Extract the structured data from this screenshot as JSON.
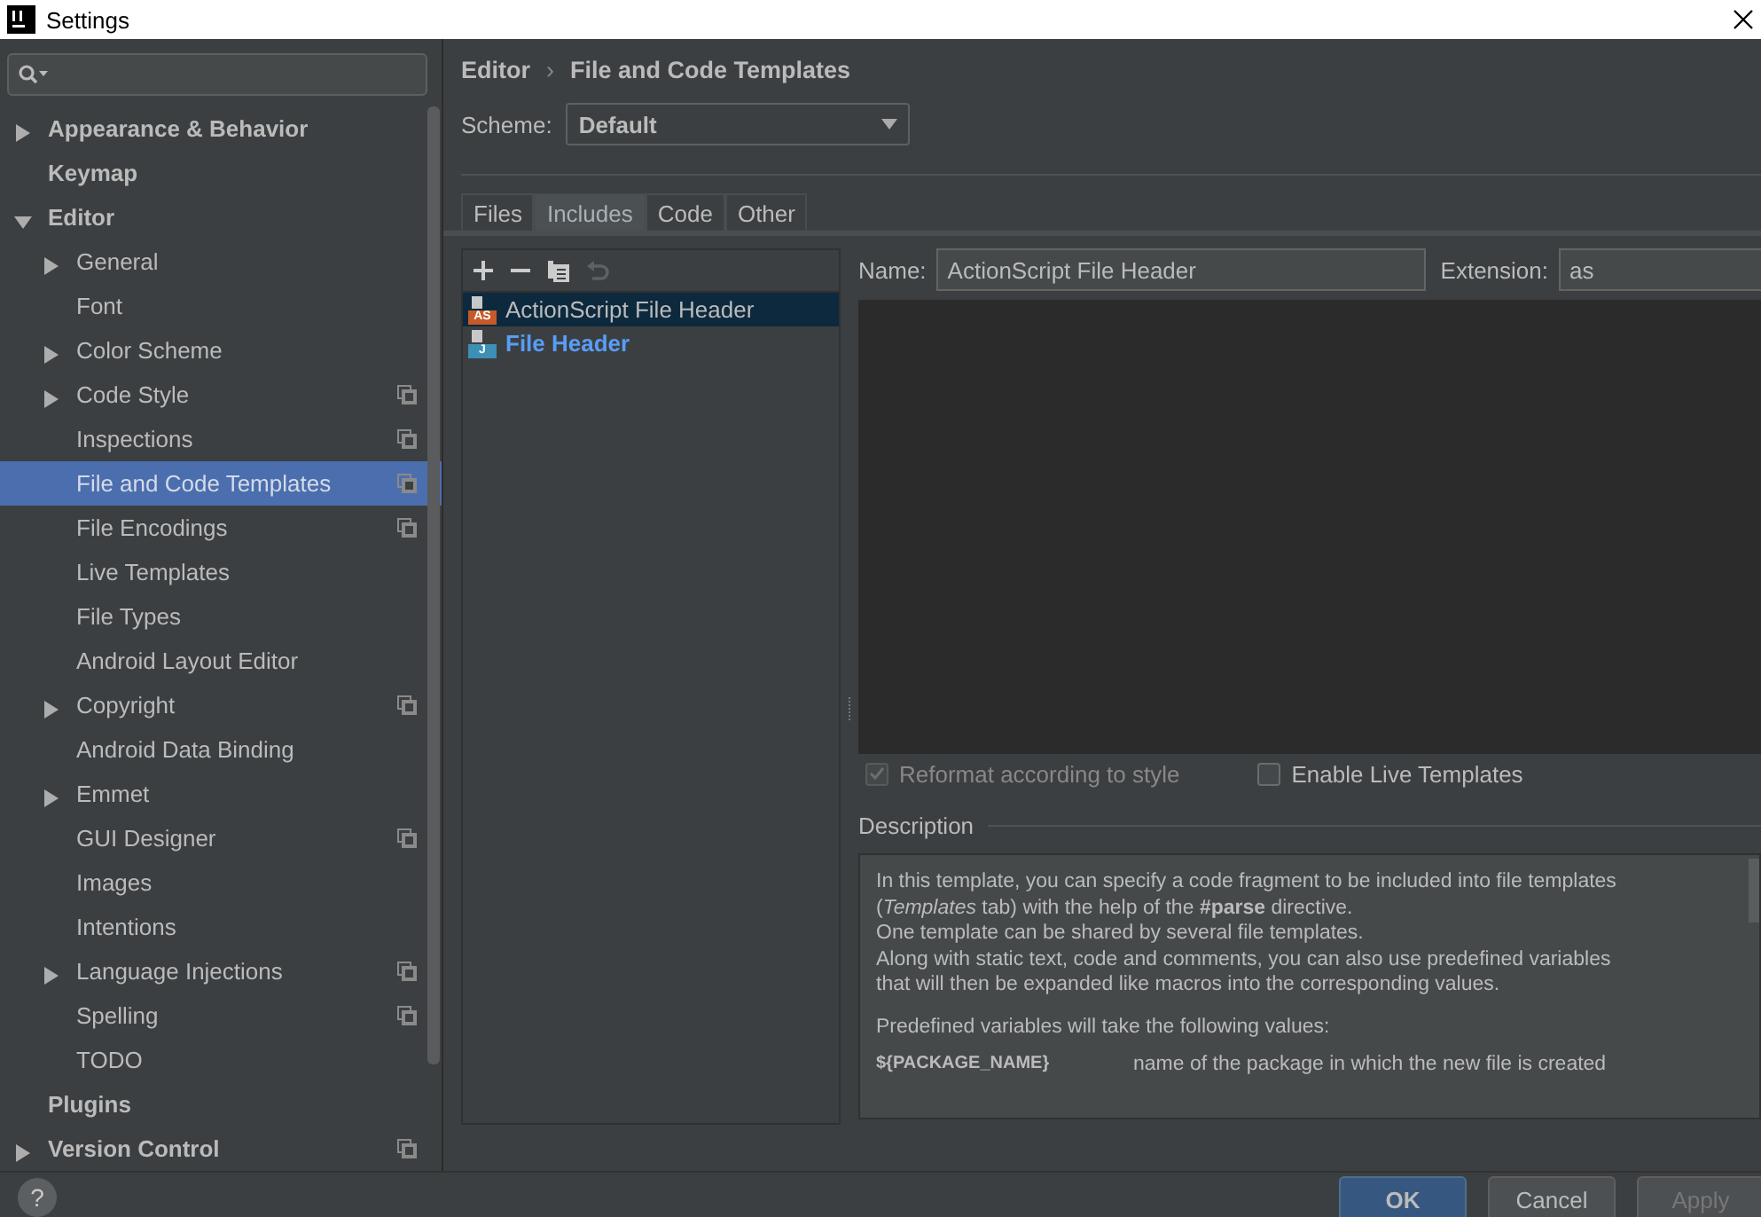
{
  "window": {
    "title": "Settings"
  },
  "sidebar": {
    "items": [
      {
        "label": "Appearance & Behavior",
        "expanded": false,
        "selected": false,
        "shared": false
      },
      {
        "label": "Keymap",
        "selected": false,
        "shared": false
      },
      {
        "label": "Editor",
        "expanded": true,
        "selected": false,
        "shared": false,
        "children": [
          {
            "label": "General",
            "expanded": false,
            "selected": false,
            "shared": false
          },
          {
            "label": "Font",
            "selected": false,
            "shared": false
          },
          {
            "label": "Color Scheme",
            "expanded": false,
            "selected": false,
            "shared": false
          },
          {
            "label": "Code Style",
            "expanded": false,
            "selected": false,
            "shared": true
          },
          {
            "label": "Inspections",
            "selected": false,
            "shared": true
          },
          {
            "label": "File and Code Templates",
            "selected": true,
            "shared": true
          },
          {
            "label": "File Encodings",
            "selected": false,
            "shared": true
          },
          {
            "label": "Live Templates",
            "selected": false,
            "shared": false
          },
          {
            "label": "File Types",
            "selected": false,
            "shared": false
          },
          {
            "label": "Android Layout Editor",
            "selected": false,
            "shared": false
          },
          {
            "label": "Copyright",
            "expanded": false,
            "selected": false,
            "shared": true
          },
          {
            "label": "Android Data Binding",
            "selected": false,
            "shared": false
          },
          {
            "label": "Emmet",
            "expanded": false,
            "selected": false,
            "shared": false
          },
          {
            "label": "GUI Designer",
            "selected": false,
            "shared": true
          },
          {
            "label": "Images",
            "selected": false,
            "shared": false
          },
          {
            "label": "Intentions",
            "selected": false,
            "shared": false
          },
          {
            "label": "Language Injections",
            "expanded": false,
            "selected": false,
            "shared": true
          },
          {
            "label": "Spelling",
            "selected": false,
            "shared": true
          },
          {
            "label": "TODO",
            "selected": false,
            "shared": false
          }
        ]
      },
      {
        "label": "Plugins",
        "selected": false,
        "shared": false
      },
      {
        "label": "Version Control",
        "expanded": false,
        "selected": false,
        "shared": true
      }
    ]
  },
  "breadcrumb": [
    "Editor",
    "File and Code Templates"
  ],
  "breadcrumb_separator": "›",
  "scheme": {
    "label": "Scheme:",
    "value": "Default"
  },
  "tabs": [
    {
      "label": "Files",
      "selected": false
    },
    {
      "label": "Includes",
      "selected": true
    },
    {
      "label": "Code",
      "selected": false
    },
    {
      "label": "Other",
      "selected": false
    }
  ],
  "templates": [
    {
      "label": "ActionScript File Header",
      "selected": true,
      "badge": "AS",
      "color": "#c75a2a",
      "modified": false
    },
    {
      "label": "File Header",
      "selected": false,
      "badge": "J",
      "color": "#3d8fb5",
      "modified": true
    }
  ],
  "name_field": {
    "label": "Name:",
    "value": "ActionScript File Header"
  },
  "extension_field": {
    "label": "Extension:",
    "value": "as"
  },
  "options": [
    {
      "label": "Reformat according to style",
      "checked": true,
      "disabled": true
    },
    {
      "label": "Enable Live Templates",
      "checked": false,
      "disabled": false
    }
  ],
  "description": {
    "title": "Description",
    "lines": [
      "In this template, you can specify a code fragment to be included into file templates",
      "(*Templates* tab) with the help of the **#parse** directive.",
      "One template can be shared by several file templates.",
      "Along with static text, code and comments, you can also use predefined variables",
      "that will then be expanded like macros into the corresponding values."
    ],
    "variables_intro": "Predefined variables will take the following values:",
    "variables": [
      {
        "name": "${PACKAGE_NAME}",
        "meaning": "name of the package in which the new file is created"
      }
    ]
  },
  "help": "?",
  "buttons": [
    {
      "label": "OK",
      "kind": "primary"
    },
    {
      "label": "Cancel",
      "kind": "normal"
    },
    {
      "label": "Apply",
      "kind": "disabled"
    }
  ]
}
